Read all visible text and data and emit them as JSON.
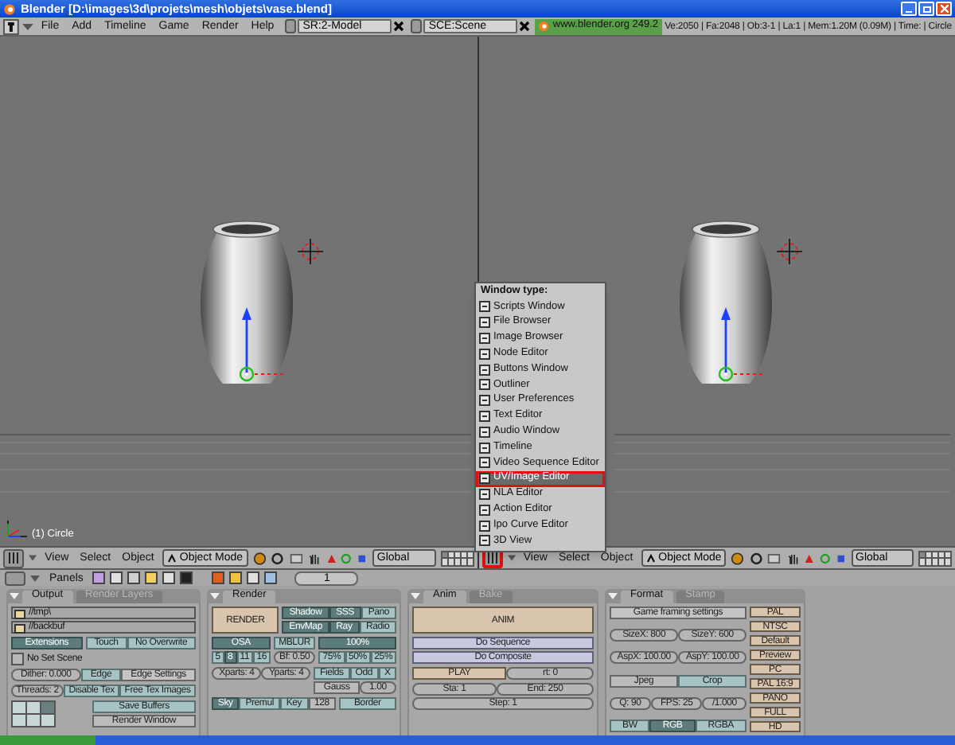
{
  "window": {
    "title": "Blender [D:\\images\\3d\\projets\\mesh\\objets\\vase.blend]"
  },
  "menubar": {
    "menus": [
      "File",
      "Add",
      "Timeline",
      "Game",
      "Render",
      "Help"
    ],
    "screen": "SR:2-Model",
    "scene": "SCE:Scene",
    "version": "www.blender.org 249.2",
    "stats": "Ve:2050 | Fa:2048 | Ob:3-1 | La:1 | Mem:1.20M (0.09M) | Time: | Circle"
  },
  "views": [
    {
      "object_label": "(1) Circle",
      "window_type_highlighted": false,
      "menus": [
        "View",
        "Select",
        "Object"
      ],
      "mode": "Object Mode",
      "orientation": "Global"
    },
    {
      "window_type_highlighted": true,
      "menus": [
        "View",
        "Select",
        "Object"
      ],
      "mode": "Object Mode",
      "orientation": "Global"
    }
  ],
  "window_type_menu": {
    "title": "Window type:",
    "items": [
      {
        "label": "Scripts Window",
        "selected": false
      },
      {
        "label": "File Browser",
        "selected": false
      },
      {
        "label": "Image Browser",
        "selected": false
      },
      {
        "label": "Node Editor",
        "selected": false
      },
      {
        "label": "Buttons Window",
        "selected": false
      },
      {
        "label": "Outliner",
        "selected": false
      },
      {
        "label": "User Preferences",
        "selected": false
      },
      {
        "label": "Text Editor",
        "selected": false
      },
      {
        "label": "Audio Window",
        "selected": false
      },
      {
        "label": "Timeline",
        "selected": false
      },
      {
        "label": "Video Sequence Editor",
        "selected": false
      },
      {
        "label": "UV/Image Editor",
        "selected": true
      },
      {
        "label": "NLA Editor",
        "selected": false
      },
      {
        "label": "Action Editor",
        "selected": false
      },
      {
        "label": "Ipo Curve Editor",
        "selected": false
      },
      {
        "label": "3D View",
        "selected": false
      }
    ]
  },
  "buttons_header": {
    "label": "Panels",
    "frame": "1"
  },
  "panels": [
    {
      "tabs": [
        {
          "label": "Output",
          "selected": true
        },
        {
          "label": "Render Layers",
          "selected": false
        }
      ],
      "blocks": [
        {
          "rows": [
            {
              "items": [
                {
                  "kind": "field",
                  "label": "//tmp\\"
                }
              ]
            },
            {
              "items": [
                {
                  "kind": "field",
                  "label": "//backbuf"
                }
              ]
            }
          ]
        },
        {
          "columns": [
            {
              "rows": [
                {
                  "items": [
                    {
                      "kind": "toggle",
                      "label": "Extensions",
                      "on": true
                    }
                  ]
                }
              ]
            },
            {
              "rows": [
                {
                  "items": [
                    {
                      "kind": "toggle",
                      "label": "Touch",
                      "on": false
                    },
                    {
                      "kind": "toggle",
                      "label": "No Overwrite",
                      "on": false
                    }
                  ]
                }
              ]
            }
          ]
        },
        {
          "rows": [
            {
              "items": [
                {
                  "kind": "browse",
                  "label": "No Set Scene"
                }
              ]
            }
          ]
        },
        {
          "rows": [
            {
              "items": [
                {
                  "kind": "num",
                  "label": "Dither: 0.000"
                },
                {
                  "kind": "toggle",
                  "label": "Edge",
                  "on": false
                },
                {
                  "kind": "button",
                  "label": "Edge Settings"
                }
              ]
            }
          ]
        },
        {
          "rows": [
            {
              "items": [
                {
                  "kind": "num",
                  "label": "Threads: 2"
                },
                {
                  "kind": "toggle",
                  "label": "Disable Tex",
                  "on": false
                },
                {
                  "kind": "toggle",
                  "label": "Free Tex Images",
                  "on": false
                }
              ]
            }
          ]
        },
        {
          "columns": [
            {
              "rows": [
                {
                  "items": [
                    {
                      "kind": "grid"
                    }
                  ]
                }
              ]
            },
            {
              "rows": [
                {
                  "items": [
                    {
                      "kind": "toggle",
                      "label": "Save Buffers",
                      "on": false
                    }
                  ]
                },
                {
                  "items": [
                    {
                      "kind": "menu",
                      "label": "Render Window"
                    }
                  ]
                }
              ]
            }
          ]
        }
      ]
    },
    {
      "tabs": [
        {
          "label": "Render",
          "selected": true
        }
      ],
      "blocks": [
        {
          "columns": [
            {
              "rows": [
                {
                  "items": [
                    {
                      "kind": "action",
                      "label": "RENDER"
                    }
                  ]
                }
              ]
            },
            {
              "rows": [
                {
                  "items": [
                    {
                      "kind": "toggle",
                      "label": "Shadow",
                      "on": true
                    },
                    {
                      "kind": "toggle",
                      "label": "SSS",
                      "on": true
                    },
                    {
                      "kind": "toggle",
                      "label": "Pano",
                      "on": false
                    }
                  ]
                },
                {
                  "items": [
                    {
                      "kind": "toggle",
                      "label": "EnvMap",
                      "on": true
                    },
                    {
                      "kind": "toggle",
                      "label": "Ray",
                      "on": true
                    },
                    {
                      "kind": "toggle",
                      "label": "Radio",
                      "on": false
                    }
                  ]
                }
              ]
            }
          ]
        },
        {
          "columns": [
            {
              "header": {
                "kind": "toggle",
                "label": "OSA",
                "on": true
              },
              "rows": [
                {
                  "items": [
                    {
                      "kind": "toggle",
                      "label": "5",
                      "on": false
                    },
                    {
                      "kind": "toggle",
                      "label": "8",
                      "on": true
                    },
                    {
                      "kind": "toggle",
                      "label": "11",
                      "on": false
                    },
                    {
                      "kind": "toggle",
                      "label": "16",
                      "on": false
                    }
                  ]
                }
              ]
            },
            {
              "header": {
                "kind": "toggle",
                "label": "MBLUR",
                "on": false
              },
              "rows": [
                {
                  "items": [
                    {
                      "kind": "num",
                      "label": "Bf: 0.50"
                    }
                  ]
                }
              ]
            },
            {
              "header": {
                "kind": "toggle",
                "label": "100%",
                "on": true
              },
              "rows": [
                {
                  "items": [
                    {
                      "kind": "toggle",
                      "label": "75%",
                      "on": false
                    },
                    {
                      "kind": "toggle",
                      "label": "50%",
                      "on": false
                    },
                    {
                      "kind": "toggle",
                      "label": "25%",
                      "on": false
                    }
                  ]
                }
              ]
            }
          ]
        },
        {
          "columns": [
            {
              "rows": [
                {
                  "items": [
                    {
                      "kind": "num",
                      "label": "Xparts: 4"
                    },
                    {
                      "kind": "num",
                      "label": "Yparts: 4"
                    }
                  ]
                }
              ]
            },
            {
              "rows": [
                {
                  "items": [
                    {
                      "kind": "toggle",
                      "label": "Fields",
                      "on": false
                    },
                    {
                      "kind": "toggle",
                      "label": "Odd",
                      "on": false
                    },
                    {
                      "kind": "toggle",
                      "label": "X",
                      "on": false
                    }
                  ]
                },
                {
                  "items": [
                    {
                      "kind": "menu",
                      "label": "Gauss"
                    },
                    {
                      "kind": "num",
                      "label": "1.00"
                    }
                  ]
                }
              ]
            }
          ]
        },
        {
          "columns": [
            {
              "rows": [
                {
                  "items": [
                    {
                      "kind": "toggle",
                      "label": "Sky",
                      "on": true
                    },
                    {
                      "kind": "toggle",
                      "label": "Premul",
                      "on": false
                    },
                    {
                      "kind": "toggle",
                      "label": "Key",
                      "on": false
                    },
                    {
                      "kind": "menu",
                      "label": "128"
                    }
                  ]
                }
              ]
            },
            {
              "rows": [
                {
                  "items": [
                    {
                      "kind": "toggle",
                      "label": "Border",
                      "on": false
                    }
                  ]
                }
              ]
            }
          ]
        }
      ]
    },
    {
      "tabs": [
        {
          "label": "Anim",
          "selected": true
        },
        {
          "label": "Bake",
          "selected": false
        }
      ],
      "blocks": [
        {
          "rows": [
            {
              "items": [
                {
                  "kind": "action",
                  "label": "ANIM"
                }
              ]
            }
          ]
        },
        {
          "rows": [
            {
              "items": [
                {
                  "kind": "option",
                  "label": "Do Sequence"
                }
              ]
            },
            {
              "items": [
                {
                  "kind": "option",
                  "label": "Do Composite"
                }
              ]
            }
          ]
        },
        {
          "rows": [
            {
              "items": [
                {
                  "kind": "action",
                  "label": "PLAY"
                },
                {
                  "kind": "num",
                  "label": "rt: 0"
                }
              ]
            }
          ]
        },
        {
          "rows": [
            {
              "items": [
                {
                  "kind": "num",
                  "label": "Sta: 1"
                },
                {
                  "kind": "num",
                  "label": "End: 250"
                }
              ]
            },
            {
              "items": [
                {
                  "kind": "num",
                  "label": "Step: 1"
                }
              ]
            }
          ]
        }
      ]
    },
    {
      "tabs": [
        {
          "label": "Format",
          "selected": true
        },
        {
          "label": "Stamp",
          "selected": false
        }
      ],
      "blocks": [
        {
          "columns": [
            {
              "rows": [
                {
                  "items": [
                    {
                      "kind": "button",
                      "label": "Game framing settings"
                    }
                  ]
                },
                {
                  "items": [
                    {
                      "kind": "num",
                      "label": "SizeX: 800"
                    },
                    {
                      "kind": "num",
                      "label": "SizeY: 600"
                    }
                  ]
                },
                {
                  "items": [
                    {
                      "kind": "num",
                      "label": "AspX: 100.00"
                    },
                    {
                      "kind": "num",
                      "label": "AspY: 100.00"
                    }
                  ]
                },
                {
                  "items": [
                    {
                      "kind": "menu",
                      "label": "Jpeg"
                    },
                    {
                      "kind": "toggle",
                      "label": "Crop",
                      "on": false
                    }
                  ]
                },
                {
                  "items": [
                    {
                      "kind": "num",
                      "label": "Q: 90"
                    },
                    {
                      "kind": "num",
                      "label": "FPS: 25"
                    },
                    {
                      "kind": "num",
                      "label": "/1.000"
                    }
                  ]
                },
                {
                  "items": [
                    {
                      "kind": "toggle",
                      "label": "BW",
                      "on": false
                    },
                    {
                      "kind": "toggle",
                      "label": "RGB",
                      "on": true
                    },
                    {
                      "kind": "toggle",
                      "label": "RGBA",
                      "on": false
                    }
                  ]
                }
              ]
            },
            {
              "rows": [
                {
                  "items": [
                    {
                      "kind": "action",
                      "label": "PAL"
                    }
                  ]
                },
                {
                  "items": [
                    {
                      "kind": "action",
                      "label": "NTSC"
                    }
                  ]
                },
                {
                  "items": [
                    {
                      "kind": "action",
                      "label": "Default"
                    }
                  ]
                },
                {
                  "items": [
                    {
                      "kind": "action",
                      "label": "Preview"
                    }
                  ]
                },
                {
                  "items": [
                    {
                      "kind": "action",
                      "label": "PC"
                    }
                  ]
                },
                {
                  "items": [
                    {
                      "kind": "action",
                      "label": "PAL 16:9"
                    }
                  ]
                },
                {
                  "items": [
                    {
                      "kind": "action",
                      "label": "PANO"
                    }
                  ]
                },
                {
                  "items": [
                    {
                      "kind": "action",
                      "label": "FULL"
                    }
                  ]
                },
                {
                  "items": [
                    {
                      "kind": "action",
                      "label": "HD"
                    }
                  ]
                }
              ]
            }
          ]
        }
      ]
    }
  ]
}
